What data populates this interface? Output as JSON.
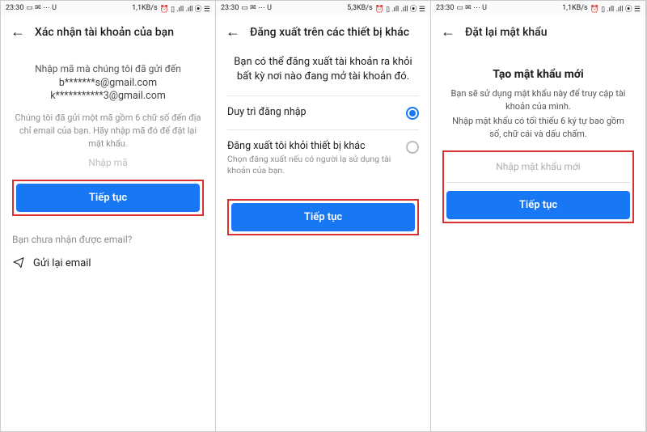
{
  "status": {
    "time": "23:30",
    "icons_left": [
      "▭",
      "✉",
      "⋯",
      "U"
    ],
    "speed_a": "1,1KB/s",
    "speed_b": "5,3KB/s",
    "speed_c": "1,1KB/s",
    "right_cluster": "⏰ ▯ .ıll .ıll ⦿ ☰"
  },
  "screen1": {
    "title": "Xác nhận tài khoản của bạn",
    "intro": "Nhập mã mà chúng tôi đã gửi đến",
    "email1": "b*******s@gmail.com",
    "email2": "k***********3@gmail.com",
    "hint": "Chúng tôi đã gửi một mã gồm 6 chữ số đến địa chỉ email của bạn. Hãy nhập mã đó để đặt lại mật khẩu.",
    "input_placeholder": "Nhập mã",
    "continue": "Tiếp tục",
    "no_email": "Bạn chưa nhận được email?",
    "resend": "Gửi lại email"
  },
  "screen2": {
    "title": "Đăng xuất trên các thiết bị khác",
    "head": "Bạn có thể đăng xuất tài khoản ra khỏi bất kỳ nơi nào đang mở tài khoản đó.",
    "opt1_title": "Duy trì đăng nhập",
    "opt2_title": "Đăng xuất tôi khỏi thiết bị khác",
    "opt2_sub": "Chọn đăng xuất nếu có người lạ sử dụng tài khoản của bạn.",
    "continue": "Tiếp tục"
  },
  "screen3": {
    "title": "Đặt lại mật khẩu",
    "heading": "Tạo mật khẩu mới",
    "sub1": "Bạn sẽ sử dụng mật khẩu này để truy cập tài khoản của mình.",
    "sub2": "Nhập mật khẩu có tối thiểu 6 ký tự bao gồm số, chữ cái và dấu chấm.",
    "input_placeholder": "Nhập mật khẩu mới",
    "continue": "Tiếp tục"
  }
}
